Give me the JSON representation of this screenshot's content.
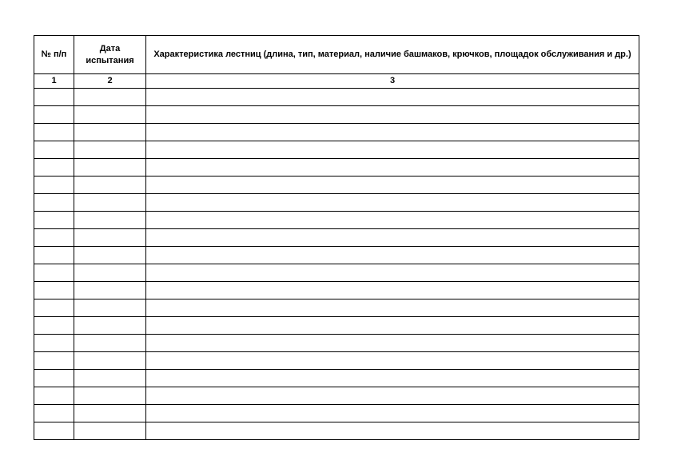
{
  "table": {
    "headers": {
      "col1": "№ п/п",
      "col2": "Дата испытания",
      "col3": "Характеристика лестниц (длина, тип, материал, наличие башмаков, крючков, площадок обслуживания и др.)"
    },
    "colnums": {
      "c1": "1",
      "c2": "2",
      "c3": "3"
    },
    "rowCount": 20
  }
}
